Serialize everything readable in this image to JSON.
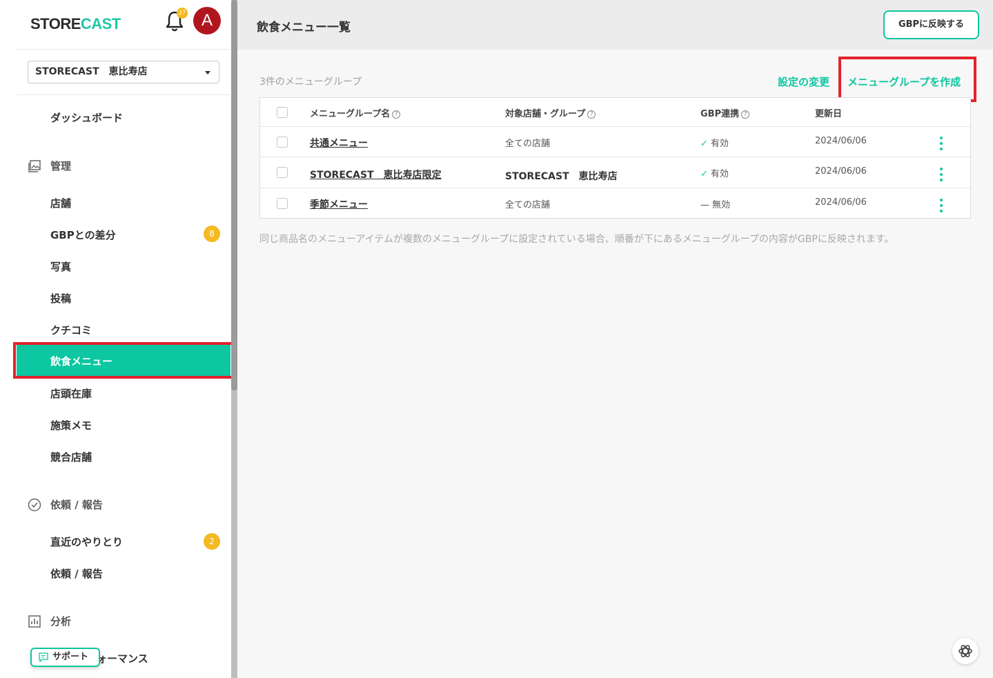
{
  "brand": {
    "logo_part1": "STORE",
    "logo_part2": "CAST",
    "accent": "#0cc7a1"
  },
  "header": {
    "notification_count": "27",
    "avatar_letter": "A"
  },
  "store_selector": {
    "value": "STORECAST　恵比寿店"
  },
  "sidebar": {
    "dashboard": "ダッシュボード",
    "section_manage": "管理",
    "manage_items": [
      {
        "label": "店舗"
      },
      {
        "label": "GBPとの差分",
        "badge": "8"
      },
      {
        "label": "写真"
      },
      {
        "label": "投稿"
      },
      {
        "label": "クチコミ"
      },
      {
        "label": "飲食メニュー"
      },
      {
        "label": "店頭在庫"
      },
      {
        "label": "施策メモ"
      },
      {
        "label": "競合店舗"
      }
    ],
    "section_requests": "依頼 / 報告",
    "request_items": [
      {
        "label": "直近のやりとり",
        "badge": "2"
      },
      {
        "label": "依頼 / 報告"
      }
    ],
    "section_analysis": "分析",
    "analysis_items": [
      {
        "label": "パフォーマンス"
      }
    ],
    "support": "サポート",
    "partial_visible": "ォーマンス"
  },
  "page": {
    "title": "飲食メニュー一覧",
    "gbp_button": "GBPに反映する",
    "count_label": "3件のメニューグループ",
    "settings_link": "設定の変更",
    "create_link": "メニューグループを作成"
  },
  "table": {
    "headers": {
      "name": "メニューグループ名",
      "target": "対象店舗・グループ",
      "gbp": "GBP連携",
      "updated": "更新日"
    },
    "rows": [
      {
        "name": "共通メニュー",
        "target": "全ての店舗",
        "gbp": "有効",
        "gbp_on": true,
        "updated": "2024/06/06"
      },
      {
        "name": "STORECAST　恵比寿店限定",
        "target": "STORECAST　恵比寿店",
        "gbp": "有効",
        "gbp_on": true,
        "updated": "2024/06/06"
      },
      {
        "name": "季節メニュー",
        "target": "全ての店舗",
        "gbp": "無効",
        "gbp_on": false,
        "updated": "2024/06/06"
      }
    ]
  },
  "note": "同じ商品名のメニューアイテムが複数のメニューグループに設定されている場合、順番が下にあるメニューグループの内容がGBPに反映されます。"
}
